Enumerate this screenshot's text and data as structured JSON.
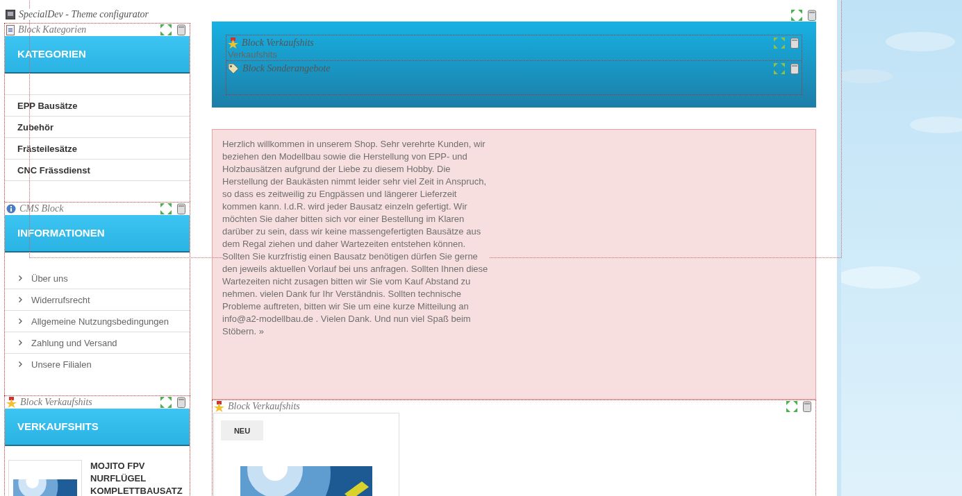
{
  "theme_configurator": {
    "label": "SpecialDev - Theme configurator"
  },
  "welcome_text": "Herzlich willkommen in unserem Shop. Sehr verehrte Kunden, wir beziehen den Modellbau sowie die Herstellung von EPP- und Holzbausätzen aufgrund der Liebe zu diesem Hobby. Die Herstellung der Baukästen nimmt leider sehr viel Zeit in Anspruch, so dass es zeitweilig zu Engpässen und längerer Lieferzeit kommen kann. I.d.R. wird jeder Bausatz einzeln gefertigt. Wir möchten Sie daher bitten sich vor einer Bestellung im Klaren darüber zu sein, dass wir keine massengefertigten Bausätze aus dem Regal ziehen und daher Wartezeiten entstehen können. Sollten Sie kurzfristig einen Bausatz benötigen dürfen Sie gerne den jeweils aktuellen Vorlauf bei uns anfragen. Sollten Ihnen diese Wartezeiten nicht zusagen bitten wir Sie vom Kauf Abstand zu nehmen. vielen Dank fur Ihr Verständnis. Sollten technische Probleme auftreten, bitten wir Sie um eine kurze Mitteilung an info@a2-modellbau.de . Vielen Dank. Und nun viel Spaß beim Stöbern. »",
  "sidebar": [
    {
      "kind": "categories",
      "label": "Block Kategorien",
      "heading": "KATEGORIEN",
      "items": [
        "EPP Bausätze",
        "Zubehör",
        "Frästeilesätze",
        "CNC Frässdienst"
      ]
    },
    {
      "kind": "links",
      "label": "CMS Block",
      "heading": "INFORMATIONEN",
      "items": [
        "Über uns",
        "Widerrufsrecht",
        "Allgemeine Nutzungsbedingungen",
        "Zahlung und Versand",
        "Unsere Filialen"
      ]
    },
    {
      "kind": "products",
      "label": "Block Verkaufshits",
      "heading": "VERKAUFSHITS",
      "products": [
        {
          "title": "MOJITO FPV NURFLÜGEL KOMPLETTBAUSATZ"
        }
      ]
    }
  ],
  "top_banner": [
    {
      "kind": "bestsellers",
      "label": "Block Verkaufshits",
      "content": "Verkaufshits"
    },
    {
      "kind": "specials",
      "label": "Block Sonderangebote"
    }
  ],
  "main_block": {
    "kind": "bestsellers",
    "label": "Block Verkaufshits",
    "products": [
      {
        "badge": "NEU"
      }
    ]
  }
}
